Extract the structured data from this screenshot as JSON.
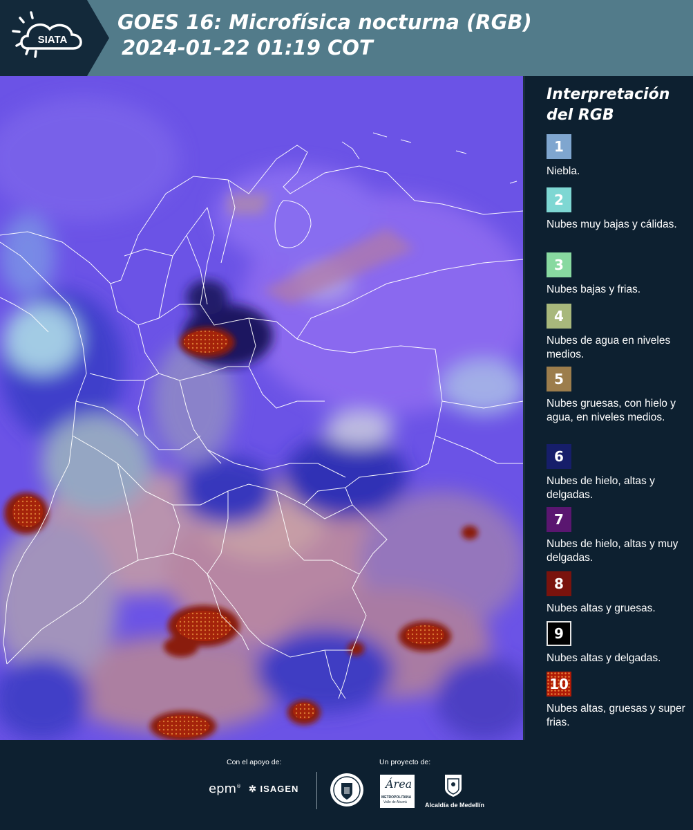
{
  "header": {
    "logo_text": "SIATA",
    "title_line1": "GOES 16: Microfísica nocturna (RGB)",
    "title_line2": "2024-01-22 01:19 COT"
  },
  "map": {
    "colors": {
      "background": "#6a4fe0",
      "boundary": "#ffffff"
    }
  },
  "legend": {
    "title_line1": "Interpretación",
    "title_line2": "del RGB",
    "items": [
      {
        "number": "1",
        "label": "Niebla.",
        "color": "#7fa6cf"
      },
      {
        "number": "2",
        "label": "Nubes muy bajas y cálidas.",
        "color": "#7ed7d3"
      },
      {
        "number": "3",
        "label": "Nubes bajas y frias.",
        "color": "#88d9a0"
      },
      {
        "number": "4",
        "label": "Nubes de agua en niveles medios.",
        "color": "#a8b87c"
      },
      {
        "number": "5",
        "label": "Nubes gruesas, con hielo y agua, en niveles medios.",
        "color": "#9c7d4c"
      },
      {
        "number": "6",
        "label": "Nubes de hielo, altas y delgadas.",
        "color": "#161e6a"
      },
      {
        "number": "7",
        "label": "Nubes de hielo, altas y muy delgadas.",
        "color": "#5a1670"
      },
      {
        "number": "8",
        "label": "Nubes altas y gruesas.",
        "color": "#7a130d"
      },
      {
        "number": "9",
        "label": "Nubes altas y delgadas.",
        "color": "#000000"
      },
      {
        "number": "10",
        "label": "Nubes altas, gruesas y super frias.",
        "color": "#b01a06"
      }
    ]
  },
  "footer": {
    "support_label": "Con el apoyo de:",
    "project_label": "Un proyecto de:",
    "sponsor_epm": "epm",
    "sponsor_isagen": "ISAGEN",
    "area_text": "Área",
    "area_subtext": "METROPOLITANA",
    "area_subtext2": "Valle de Aburrá",
    "alcaldia_text": "Alcaldía de Medellín"
  }
}
